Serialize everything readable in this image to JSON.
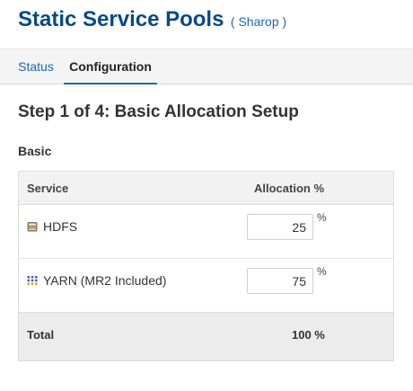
{
  "header": {
    "title": "Static Service Pools",
    "cluster_link": "( Sharop )"
  },
  "tabs": [
    {
      "label": "Status",
      "active": false
    },
    {
      "label": "Configuration",
      "active": true
    }
  ],
  "step_title": "Step 1 of 4: Basic Allocation Setup",
  "section_label": "Basic",
  "table": {
    "columns": [
      "Service",
      "Allocation %"
    ],
    "rows": [
      {
        "service": "HDFS",
        "icon": "hdfs-icon",
        "allocation": "25",
        "unit": "%"
      },
      {
        "service": "YARN (MR2 Included)",
        "icon": "yarn-icon",
        "allocation": "75",
        "unit": "%"
      }
    ],
    "total_label": "Total",
    "total_value": "100 %"
  },
  "colors": {
    "title": "#0a4a84",
    "link": "#1d66b8",
    "active_tab_underline": "#1d6fa0"
  }
}
